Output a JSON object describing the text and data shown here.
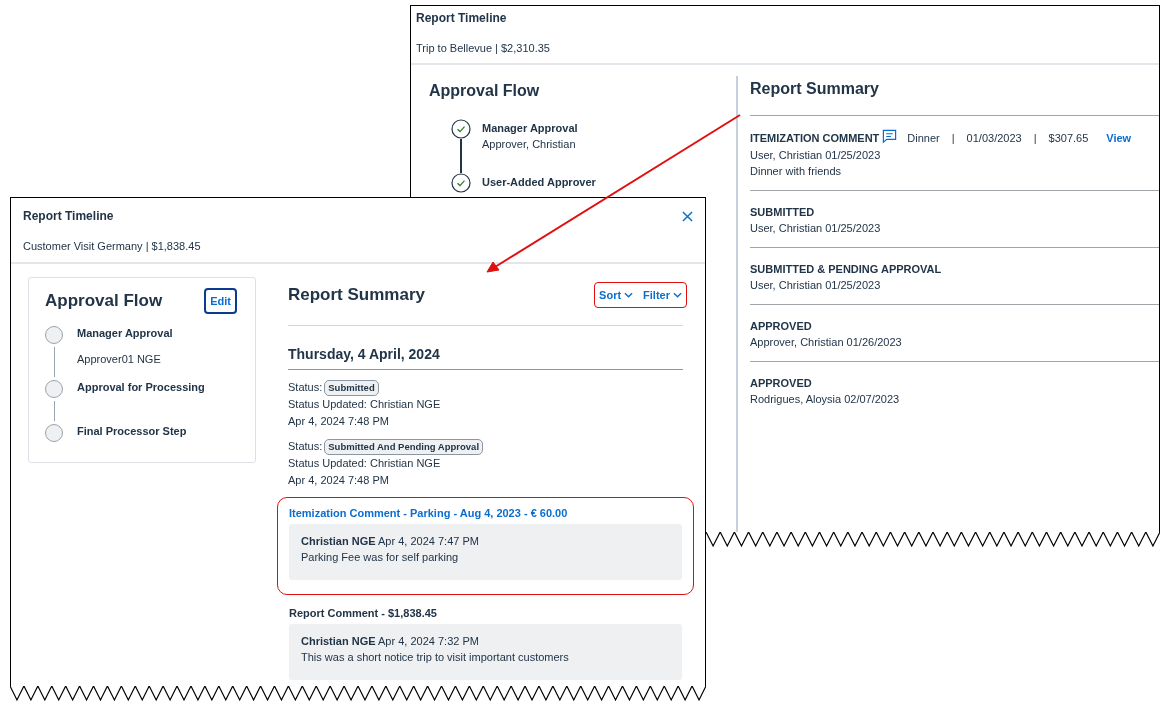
{
  "back_window": {
    "title": "Report Timeline",
    "subtitle": "Trip to Bellevue | $2,310.35",
    "approval_flow": {
      "heading": "Approval Flow",
      "steps": [
        {
          "name": "Manager Approval",
          "approver": "Approver, Christian",
          "completed": true
        },
        {
          "name": "User-Added Approver",
          "completed": true
        }
      ]
    },
    "report_summary": {
      "heading": "Report Summary",
      "entries": [
        {
          "kind": "itemization",
          "title": "ITEMIZATION COMMENT",
          "details": [
            "Dinner",
            "|",
            "01/03/2023",
            "|",
            "$307.65"
          ],
          "link": "View",
          "lines": [
            "User, Christian 01/25/2023",
            "Dinner with friends"
          ]
        },
        {
          "kind": "event",
          "title": "SUBMITTED",
          "lines": [
            "User, Christian 01/25/2023"
          ]
        },
        {
          "kind": "event",
          "title": "SUBMITTED & PENDING APPROVAL",
          "lines": [
            "User, Christian 01/25/2023"
          ]
        },
        {
          "kind": "event",
          "title": "APPROVED",
          "lines": [
            "Approver, Christian 01/26/2023"
          ]
        },
        {
          "kind": "event",
          "title": "APPROVED",
          "lines": [
            "Rodrigues, Aloysia 02/07/2023"
          ]
        }
      ]
    }
  },
  "front_window": {
    "title": "Report Timeline",
    "subtitle": "Customer Visit Germany | $1,838.45",
    "approval_flow": {
      "heading": "Approval Flow",
      "edit_button": "Edit",
      "steps": [
        {
          "name": "Manager Approval",
          "approver": "Approver01 NGE",
          "completed": false
        },
        {
          "name": "Approval for Processing",
          "completed": false
        },
        {
          "name": "Final Processor Step",
          "completed": false
        }
      ]
    },
    "report_summary": {
      "heading": "Report Summary",
      "controls": {
        "highlighted": true,
        "items": [
          "Sort",
          "Filter"
        ]
      },
      "date": "Thursday, 4 April, 2024",
      "entries": [
        {
          "kind": "status",
          "label": "Status:",
          "badge": "Submitted",
          "lines": [
            "Status Updated: Christian NGE",
            "Apr 4, 2024 7:48 PM"
          ]
        },
        {
          "kind": "status",
          "label": "Status:",
          "badge": "Submitted And Pending Approval",
          "lines": [
            "Status Updated: Christian NGE",
            "Apr 4, 2024 7:48 PM"
          ]
        },
        {
          "kind": "comment",
          "title": "Itemization Comment - Parking - Aug 4, 2023 - € 60.00",
          "link": true,
          "highlighted": true,
          "byline": "**Christian NGE** Apr 4, 2024 7:47 PM",
          "text": "Parking Fee was for self parking"
        },
        {
          "kind": "comment",
          "title": "Report Comment - $1,838.45",
          "link": false,
          "highlighted": false,
          "byline": "**Christian NGE** Apr 4, 2024 7:32 PM",
          "text": "This was a short notice trip to visit important customers"
        }
      ]
    }
  }
}
